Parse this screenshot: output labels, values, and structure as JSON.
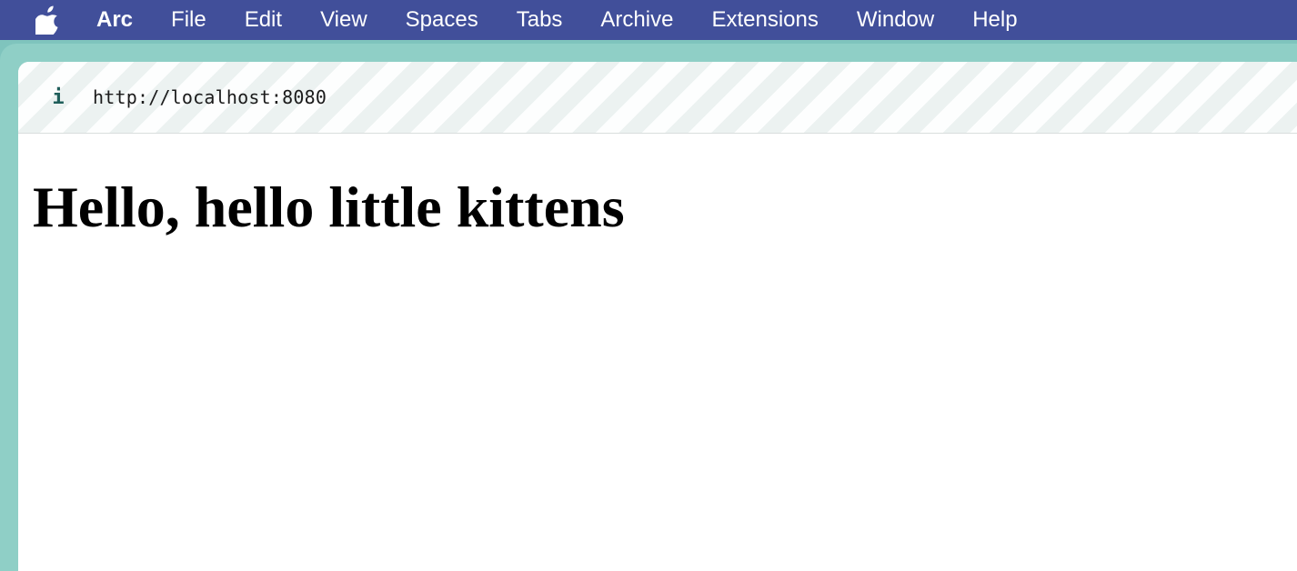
{
  "menubar": {
    "apple_icon": "apple-logo-icon",
    "app_name": "Arc",
    "items": [
      "File",
      "Edit",
      "View",
      "Spaces",
      "Tabs",
      "Archive",
      "Extensions",
      "Window",
      "Help"
    ]
  },
  "browser": {
    "info_icon": "i",
    "url": "http://localhost:8080"
  },
  "page": {
    "heading": "Hello, hello little kittens"
  },
  "colors": {
    "menubar": "#414f9a",
    "frame": "#8fcfc6",
    "info_icon": "#1f5e5a"
  }
}
